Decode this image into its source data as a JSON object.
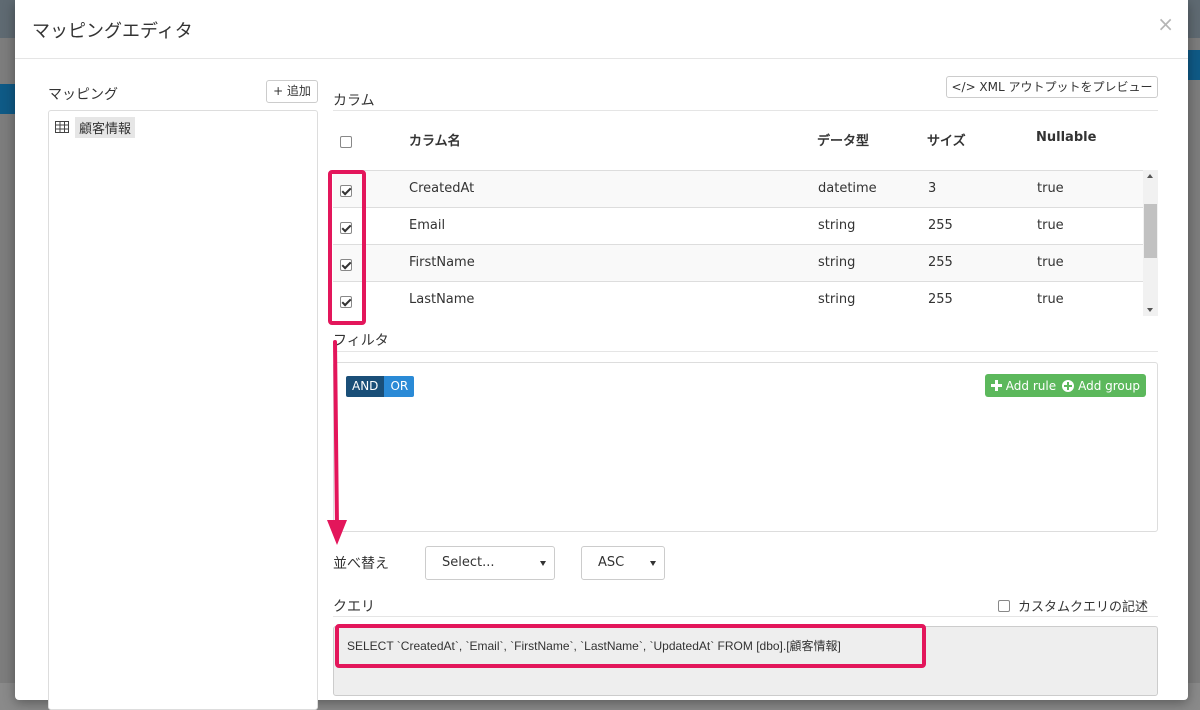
{
  "modal": {
    "title": "マッピングエディタ",
    "close_label": "×"
  },
  "left": {
    "label": "マッピング",
    "add_label": "+ 追加",
    "tree_items": [
      {
        "label": "顧客情報",
        "icon": "table-icon"
      }
    ]
  },
  "columns": {
    "section_label": "カラム",
    "preview_button": "</> XML アウトプットをプレビュー",
    "headers": {
      "name": "カラム名",
      "type": "データ型",
      "size": "サイズ",
      "nullable": "Nullable"
    },
    "rows": [
      {
        "name": "CreatedAt",
        "type": "datetime",
        "size": "3",
        "nullable": "true",
        "checked": true
      },
      {
        "name": "Email",
        "type": "string",
        "size": "255",
        "nullable": "true",
        "checked": true
      },
      {
        "name": "FirstName",
        "type": "string",
        "size": "255",
        "nullable": "true",
        "checked": true
      },
      {
        "name": "LastName",
        "type": "string",
        "size": "255",
        "nullable": "true",
        "checked": true
      }
    ]
  },
  "filter": {
    "section_label": "フィルタ",
    "and_label": "AND",
    "or_label": "OR",
    "add_rule_label": "Add rule",
    "add_group_label": "Add group"
  },
  "sort": {
    "label": "並べ替え",
    "field_value": "Select...",
    "order_value": "ASC"
  },
  "query": {
    "section_label": "クエリ",
    "custom_label": "カスタムクエリの記述",
    "text": "SELECT `CreatedAt`, `Email`, `FirstName`, `LastName`, `UpdatedAt` FROM [dbo].[顧客情報]"
  },
  "colors": {
    "highlight": "#e3165b",
    "and_button": "#1a4f78",
    "or_button": "#2a8ad6",
    "add_button": "#5cb85c"
  }
}
